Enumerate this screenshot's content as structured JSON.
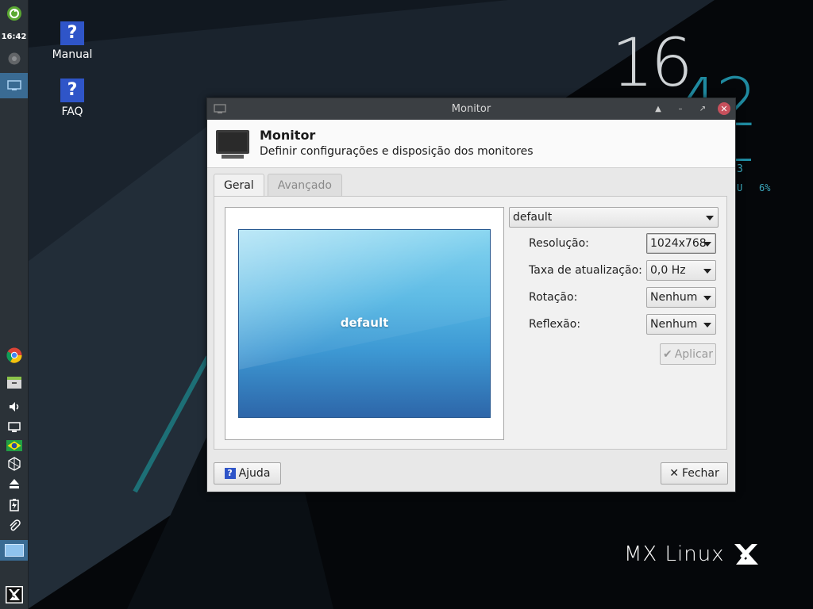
{
  "desktop": {
    "icons": [
      {
        "label": "Manual",
        "icon": "help-icon"
      },
      {
        "label": "FAQ",
        "icon": "help-icon"
      }
    ],
    "conky": {
      "hours": "16",
      "minutes": "42",
      "small_value": "3",
      "cpu_label": "U",
      "cpu_percent": "6%"
    },
    "logo_text": "MX Linux"
  },
  "panel": {
    "clock": "16:42",
    "items": [
      "updater-icon",
      "chrome-icon",
      "window-button",
      "chrome-icon",
      "file-manager-icon",
      "volume-icon",
      "display-icon",
      "brazil-flag-icon",
      "network-icon",
      "eject-icon",
      "battery-icon",
      "clipboard-icon",
      "workspace-pager",
      "mx-menu-icon"
    ]
  },
  "window": {
    "title": "Monitor",
    "header": {
      "title": "Monitor",
      "subtitle": "Definir configurações e disposição dos monitores"
    },
    "tabs": [
      {
        "label": "Geral",
        "active": true
      },
      {
        "label": "Avançado",
        "active": false
      }
    ],
    "preview_label": "default",
    "output_select": "default",
    "fields": [
      {
        "label": "Resolução:",
        "value": "1024x768"
      },
      {
        "label": "Taxa de atualização:",
        "value": "0,0 Hz"
      },
      {
        "label": "Rotação:",
        "value": "Nenhum"
      },
      {
        "label": "Reflexão:",
        "value": "Nenhum"
      }
    ],
    "apply_label": "Aplicar",
    "help_label": "Ajuda",
    "close_label": "Fechar"
  },
  "colors": {
    "accent": "#1f8aa0",
    "close_button": "#c7505c",
    "help_blue": "#2f55c8"
  }
}
